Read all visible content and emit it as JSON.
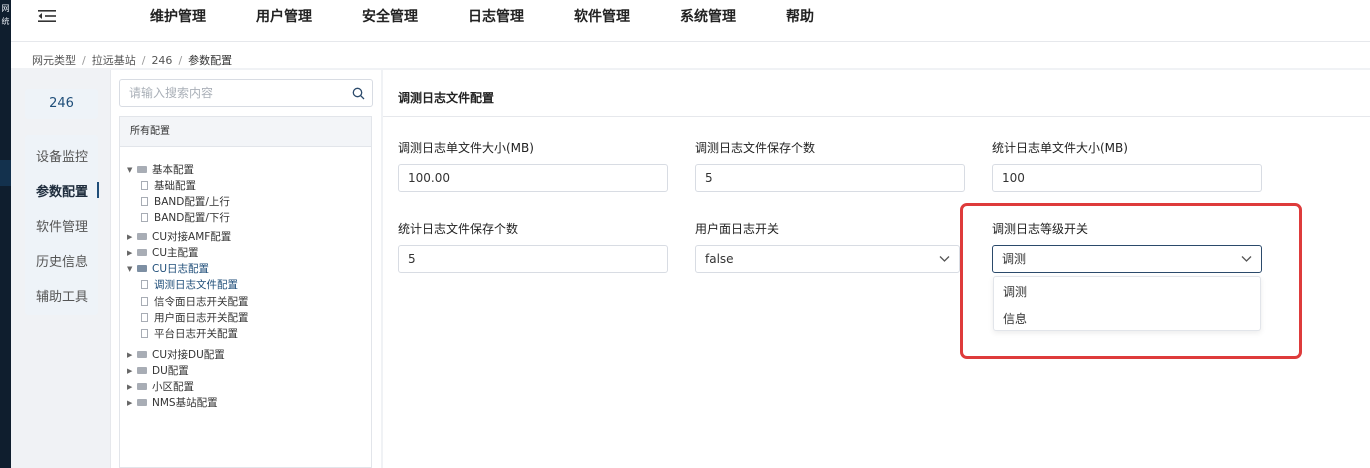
{
  "app": {
    "logo_text": "网\n统"
  },
  "header": {
    "nav": [
      "维护管理",
      "用户管理",
      "安全管理",
      "日志管理",
      "软件管理",
      "系统管理",
      "帮助"
    ]
  },
  "breadcrumb": [
    "网元类型",
    "拉远基站",
    "246",
    "参数配置"
  ],
  "device": {
    "id": "246"
  },
  "leftnav": {
    "items": [
      "设备监控",
      "参数配置",
      "软件管理",
      "历史信息",
      "辅助工具"
    ],
    "active": "参数配置"
  },
  "search": {
    "placeholder": "请输入搜索内容"
  },
  "tree": {
    "header": "所有配置",
    "nodes": [
      {
        "label": "基本配置",
        "type": "folder",
        "expanded": true
      },
      {
        "label": "基础配置",
        "type": "leaf"
      },
      {
        "label": "BAND配置/上行",
        "type": "leaf"
      },
      {
        "label": "BAND配置/下行",
        "type": "leaf"
      },
      {
        "label": "CU对接AMF配置",
        "type": "folder",
        "expanded": false
      },
      {
        "label": "CU主配置",
        "type": "folder",
        "expanded": false
      },
      {
        "label": "CU日志配置",
        "type": "folder",
        "expanded": true
      },
      {
        "label": "调测日志文件配置",
        "type": "leaf",
        "selected": true
      },
      {
        "label": "信令面日志开关配置",
        "type": "leaf"
      },
      {
        "label": "用户面日志开关配置",
        "type": "leaf"
      },
      {
        "label": "平台日志开关配置",
        "type": "leaf"
      },
      {
        "label": "CU对接DU配置",
        "type": "folder",
        "expanded": false
      },
      {
        "label": "DU配置",
        "type": "folder",
        "expanded": false
      },
      {
        "label": "小区配置",
        "type": "folder",
        "expanded": false
      },
      {
        "label": "NMS基站配置",
        "type": "folder",
        "expanded": false
      }
    ]
  },
  "main": {
    "title": "调测日志文件配置",
    "fields": [
      {
        "label": "调测日志单文件大小(MB)",
        "value": "100.00",
        "type": "input"
      },
      {
        "label": "调测日志文件保存个数",
        "value": "5",
        "type": "input"
      },
      {
        "label": "统计日志单文件大小(MB)",
        "value": "100",
        "type": "input"
      },
      {
        "label": "统计日志文件保存个数",
        "value": "5",
        "type": "input"
      },
      {
        "label": "用户面日志开关",
        "value": "false",
        "type": "select"
      },
      {
        "label": "调测日志等级开关",
        "value": "调测",
        "type": "select",
        "open": true
      }
    ],
    "dropdown_options": [
      "调测",
      "信息"
    ]
  },
  "colors": {
    "highlight": "#de3b3b",
    "accent": "#1f4e79",
    "rail": "#0f1e2e"
  }
}
